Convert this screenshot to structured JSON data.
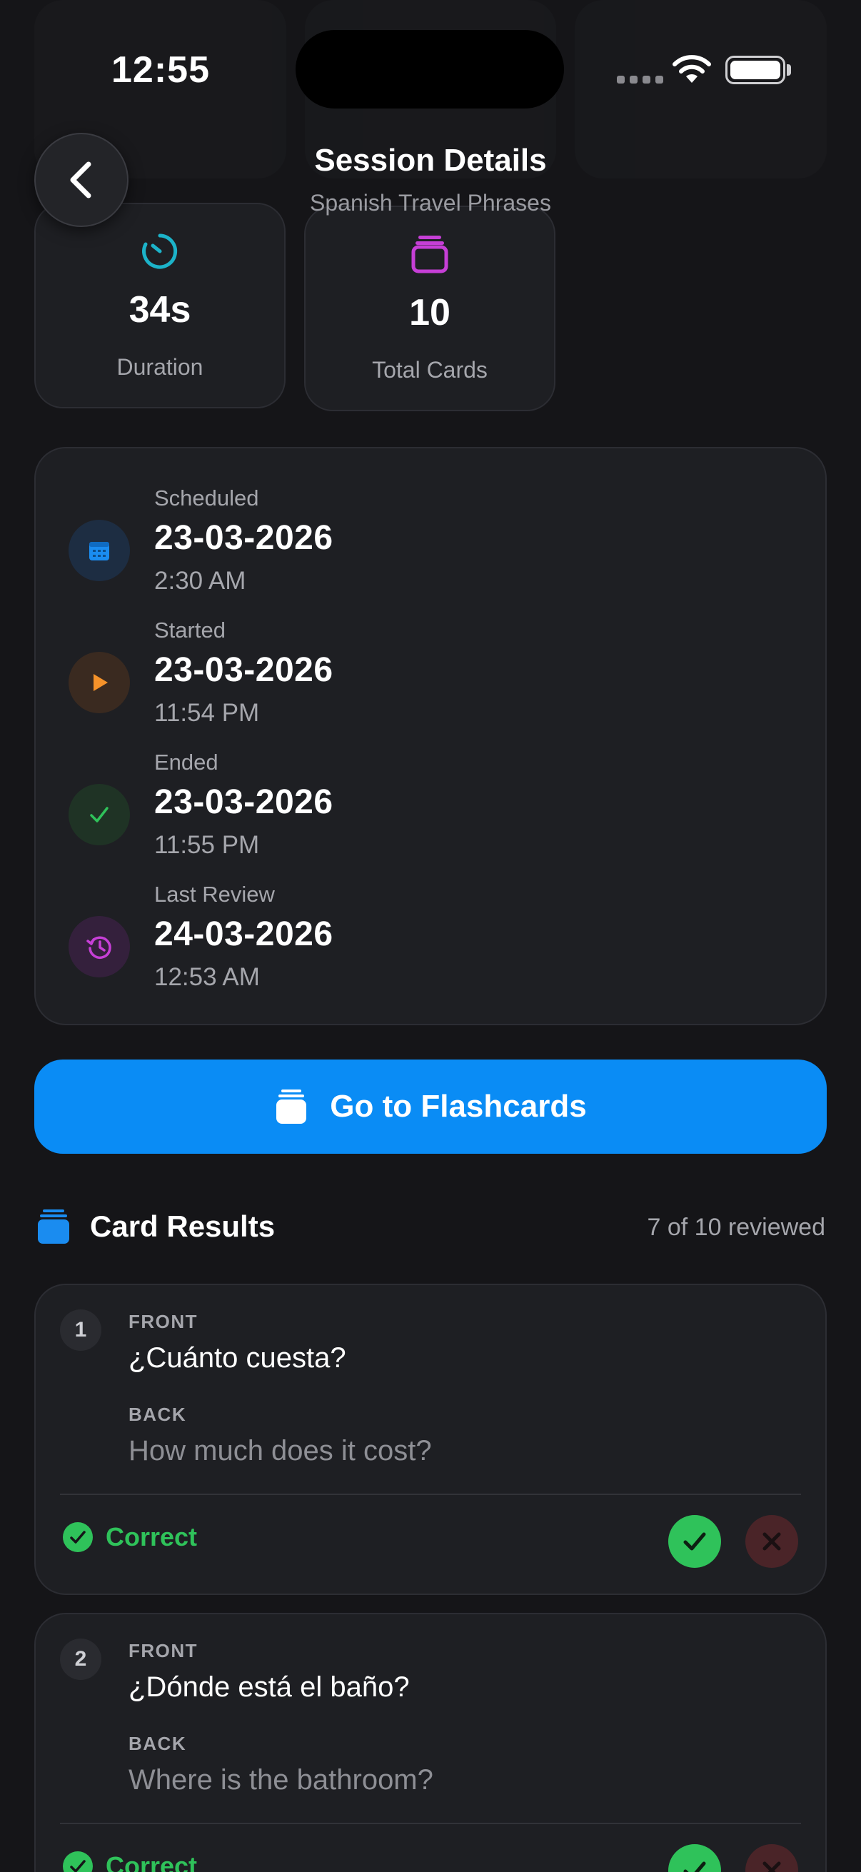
{
  "status_bar": {
    "time": "12:55"
  },
  "nav": {
    "title": "Session Details",
    "subtitle": "Spanish Travel Phrases"
  },
  "stats": [
    {
      "value": "34s",
      "label": "Duration",
      "icon": "timer-icon",
      "color": "#1cb3c9"
    },
    {
      "value": "10",
      "label": "Total Cards",
      "icon": "cards-icon",
      "color": "#c63fd6"
    }
  ],
  "timeline": [
    {
      "label": "Scheduled",
      "date": "23-03-2026",
      "time": "2:30 AM",
      "icon": "calendar-icon",
      "color": "#1a8cf0"
    },
    {
      "label": "Started",
      "date": "23-03-2026",
      "time": "11:54 PM",
      "icon": "play-icon",
      "color": "#f5922a"
    },
    {
      "label": "Ended",
      "date": "23-03-2026",
      "time": "11:55 PM",
      "icon": "check-icon",
      "color": "#2fc25a"
    },
    {
      "label": "Last Review",
      "date": "24-03-2026",
      "time": "12:53 AM",
      "icon": "history-icon",
      "color": "#c63fd6"
    }
  ],
  "primary_button": {
    "label": "Go to Flashcards"
  },
  "results": {
    "title": "Card Results",
    "count": "7 of 10 reviewed",
    "front_tag": "FRONT",
    "back_tag": "BACK",
    "cards": [
      {
        "number": "1",
        "front": "¿Cuánto cuesta?",
        "back": "How much does it cost?",
        "status": "Correct"
      },
      {
        "number": "2",
        "front": "¿Dónde está el baño?",
        "back": "Where is the bathroom?",
        "status": "Correct"
      }
    ]
  },
  "colors": {
    "accent": "#0a8cf5",
    "correct": "#2fc25a",
    "wrong_bg": "#4a2428",
    "wrong_x": "#c0393d",
    "background": "#151518",
    "card": "#1e1f23"
  }
}
